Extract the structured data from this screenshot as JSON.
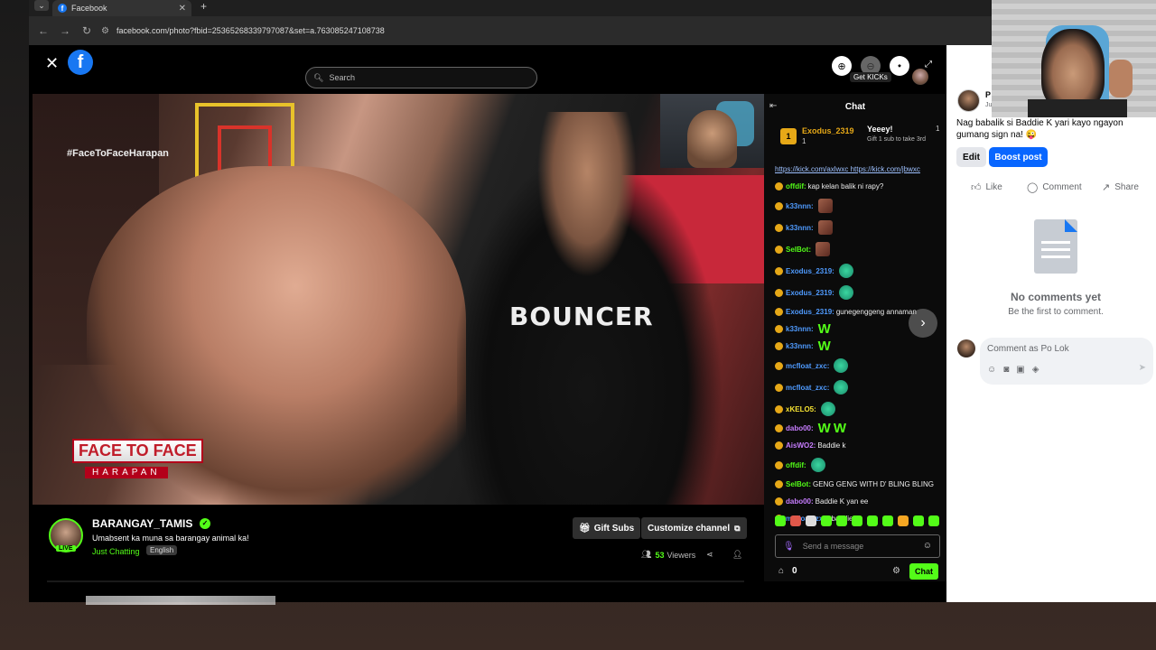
{
  "browser": {
    "tab_title": "Facebook",
    "tab_close": "✕",
    "new_tab": "+",
    "url": "facebook.com/photo?fbid=25365268339797087&set=a.763085247108738"
  },
  "viewer": {
    "search_placeholder": "Search",
    "get_kicks": "Get KICKs"
  },
  "video": {
    "hashtag": "#FaceToFaceHarapan",
    "show_logo_line1": "FACE TO FACE",
    "show_logo_line2": "HARAPAN",
    "shirt_text": "BOUNCER"
  },
  "stream": {
    "channel": "BARANGAY_TAMIS",
    "live_label": "LIVE",
    "title": "Umabsent ka muna sa barangay animal ka!",
    "category": "Just Chatting",
    "language": "English",
    "gift_label": "Gift Subs",
    "customize_label": "Customize channel",
    "viewers_count": "53",
    "viewers_label": "Viewers"
  },
  "chat": {
    "header": "Chat",
    "pinned": {
      "rank": "1",
      "user1": "Exodus_2319",
      "user1_count": "1",
      "user2": "Yeeey!",
      "user2_text": "Gift 1 sub to take 3rd",
      "user2_count": "1"
    },
    "messages": [
      {
        "user": "",
        "text": "https://kick.com/axlwxc https://kick.com/jbwxc",
        "color": "#9ec1ff",
        "emote": ""
      },
      {
        "user": "offdif:",
        "text": "kap kelan balik ni rapy?",
        "color": "#53fc18",
        "emote": ""
      },
      {
        "user": "k33nnn:",
        "text": "",
        "color": "#4f9bff",
        "emote": "photo"
      },
      {
        "user": "k33nnn:",
        "text": "",
        "color": "#4f9bff",
        "emote": "photo"
      },
      {
        "user": "SelBot:",
        "text": "",
        "color": "#53fc18",
        "emote": "photo"
      },
      {
        "user": "Exodus_2319:",
        "text": "",
        "color": "#4f9bff",
        "emote": "dino"
      },
      {
        "user": "Exodus_2319:",
        "text": "",
        "color": "#4f9bff",
        "emote": "dino"
      },
      {
        "user": "Exodus_2319:",
        "text": "gunegenggeng annaman",
        "color": "#4f9bff",
        "emote": ""
      },
      {
        "user": "k33nnn:",
        "text": "",
        "color": "#4f9bff",
        "emote": "w"
      },
      {
        "user": "k33nnn:",
        "text": "",
        "color": "#4f9bff",
        "emote": "w"
      },
      {
        "user": "mcfloat_zxc:",
        "text": "",
        "color": "#4f9bff",
        "emote": "dino"
      },
      {
        "user": "mcfloat_zxc:",
        "text": "",
        "color": "#4f9bff",
        "emote": "dino"
      },
      {
        "user": "xKELO5:",
        "text": "",
        "color": "#f5e232",
        "emote": "dino"
      },
      {
        "user": "dabo00:",
        "text": "",
        "color": "#c77dff",
        "emote": "ww"
      },
      {
        "user": "AisWO2:",
        "text": "Baddie k",
        "color": "#c77dff",
        "emote": ""
      },
      {
        "user": "offdif:",
        "text": "",
        "color": "#53fc18",
        "emote": "dino"
      },
      {
        "user": "SelBot:",
        "text": "GENG GENG WITH D' BLING BLING",
        "color": "#53fc18",
        "emote": ""
      },
      {
        "user": "dabo00:",
        "text": "Baddie K yan ee",
        "color": "#c77dff",
        "emote": ""
      },
      {
        "user": "mcfloat_zxc:",
        "text": "baddie k",
        "color": "#4f9bff",
        "emote": ""
      }
    ],
    "send_placeholder": "Send a message",
    "store_count": "0",
    "chat_button": "Chat"
  },
  "fb_post": {
    "author": "P",
    "time": "Ju",
    "text": "Nag babalik si Baddie K yari kayo ngayon gumang sign na! 😜",
    "edit_label": "Edit",
    "boost_label": "Boost post",
    "like_label": "Like",
    "comment_label": "Comment",
    "share_label": "Share",
    "no_comments": "No comments yet",
    "be_first": "Be the first to comment.",
    "comment_placeholder": "Comment as Po Lok"
  },
  "colors": {
    "kick_green": "#53fc18",
    "fb_blue": "#0866ff"
  }
}
